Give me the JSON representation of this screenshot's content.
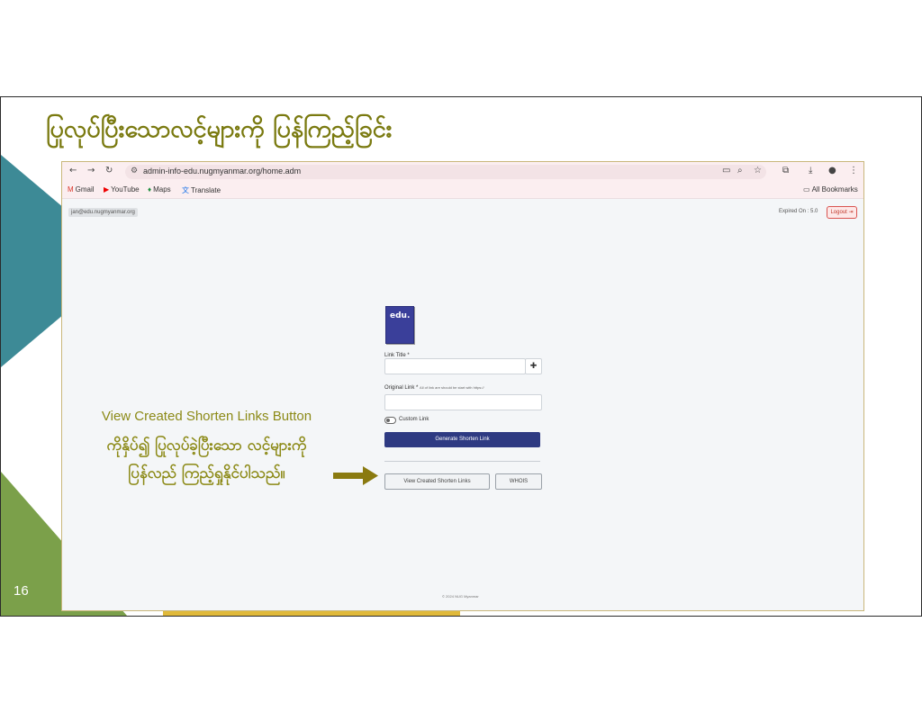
{
  "slide": {
    "title": "ပြုလုပ်ပြီးသောလင့်များကို ပြန်ကြည့်ခြင်း",
    "page_number": "16",
    "annotation_en": "View Created Shorten Links Button",
    "annotation_my_line1": "ကိုနှိပ်၍ ပြုလုပ်ခဲ့ပြီးသော လင့်များကို",
    "annotation_my_line2": "ပြန်လည် ကြည့်ရှုနိုင်ပါသည်။",
    "colors": {
      "title": "#7a7a10",
      "teal": "#3d8a96",
      "green": "#7ba04a",
      "arrow": "#8a7a10"
    }
  },
  "browser": {
    "url": "admin-info-edu.nugmyanmar.org/home.adm",
    "bookmarks": [
      {
        "icon": "gmail-icon",
        "label": "Gmail"
      },
      {
        "icon": "youtube-icon",
        "label": "YouTube"
      },
      {
        "icon": "maps-icon",
        "label": "Maps"
      },
      {
        "icon": "translate-icon",
        "label": "Translate"
      }
    ],
    "all_bookmarks": "All Bookmarks"
  },
  "app": {
    "user_email": "jan@edu.nugmyanmar.org",
    "expired_on": "Expired On : 5.0",
    "logout_label": "Logout",
    "logo_text": "edu.",
    "link_title_label": "Link Title *",
    "original_link_label": "Original Link *",
    "original_link_hint": "All of link are should be start with https://",
    "custom_link_label": "Custom Link",
    "generate_button": "Generate Shorten Link",
    "view_created_button": "View Created Shorten Links",
    "whois_button": "WHOIS",
    "copyright": "© 2024 NUG Myanmar"
  }
}
